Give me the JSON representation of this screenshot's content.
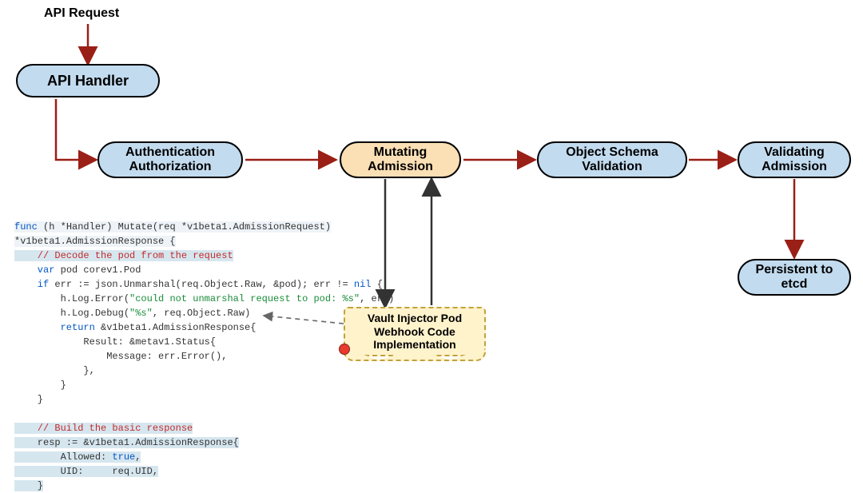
{
  "labels": {
    "api_request": "API Request"
  },
  "nodes": {
    "api_handler": "API Handler",
    "authn_authz_l1": "Authentication",
    "authn_authz_l2": "Authorization",
    "mutating_l1": "Mutating",
    "mutating_l2": "Admission",
    "schema_l1": "Object Schema",
    "schema_l2": "Validation",
    "validating_l1": "Validating",
    "validating_l2": "Admission",
    "persist_l1": "Persistent to",
    "persist_l2": "etcd",
    "note_l1": "Vault Injector Pod",
    "note_l2": "Webhook Code",
    "note_l3": "Implementation"
  },
  "code": {
    "l01a": "func",
    "l01b": " (h *Handler) Mutate(req *v1beta1.AdmissionRequest)",
    "l02": "*v1beta1.AdmissionResponse {",
    "l03": "    // Decode the pod from the request",
    "l04a": "    var",
    "l04b": " pod corev1.Pod",
    "l05a": "    if",
    "l05b": " err := json.Unmarshal(req.Object.Raw, &pod); err != ",
    "l05c": "nil",
    "l05d": " {",
    "l06a": "        h.Log.Error(",
    "l06b": "\"could not unmarshal request to pod: %s\"",
    "l06c": ", err)",
    "l07a": "        h.Log.Debug(",
    "l07b": "\"%s\"",
    "l07c": ", req.Object.Raw)",
    "l08a": "        return",
    "l08b": " &v1beta1.AdmissionResponse{",
    "l09": "            Result: &metav1.Status{",
    "l10": "                Message: err.Error(),",
    "l11": "            },",
    "l12": "        }",
    "l13": "    }",
    "l14": "",
    "l15": "    // Build the basic response",
    "l16": "    resp := &v1beta1.AdmissionResponse{",
    "l17a": "        Allowed: ",
    "l17b": "true",
    "l17c": ",",
    "l18": "        UID:     req.UID,",
    "l19": "    }"
  }
}
